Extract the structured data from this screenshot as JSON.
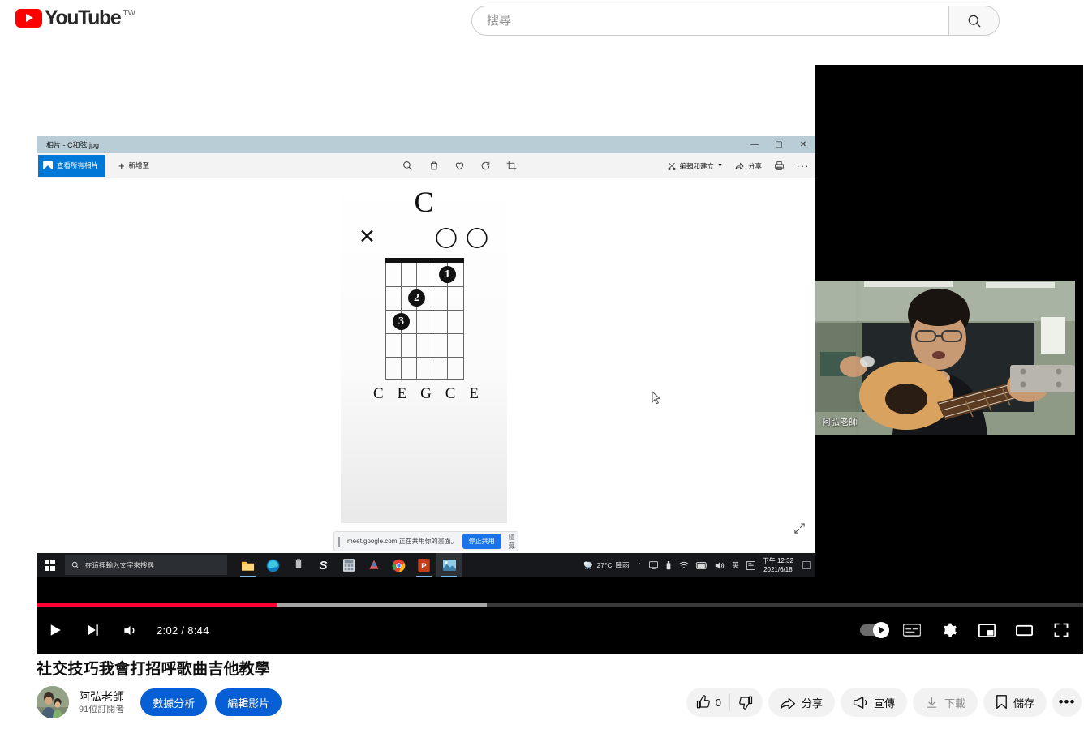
{
  "masthead": {
    "logo_text": "YouTube",
    "country_code": "TW",
    "logo_icon": "youtube-play-icon",
    "search": {
      "placeholder": "搜尋",
      "value": "",
      "button_icon": "search-icon"
    }
  },
  "player": {
    "time_display": "2:02 / 8:44",
    "current_time": "2:02",
    "duration": "8:44",
    "progress_played_pct": 23,
    "progress_buffer_pct": 43,
    "accent_color": "#ff0033",
    "controls": {
      "play_icon": "play-icon",
      "next_icon": "next-video-icon",
      "volume_icon": "volume-icon",
      "autoplay_icon": "autoplay-toggle",
      "subtitles_icon": "subtitles-icon",
      "settings_icon": "gear-icon",
      "miniplayer_icon": "miniplayer-icon",
      "theater_icon": "theater-mode-icon",
      "fullscreen_icon": "fullscreen-icon"
    },
    "webcam_overlay": {
      "name_label": "阿弘老師"
    }
  },
  "photos_app": {
    "window_title": "相片 - C和弦.jpg",
    "minimize_glyph": "—",
    "maximize_glyph": "▢",
    "close_glyph": "✕",
    "view_all_label": "查看所有相片",
    "add_to_label": "新增至",
    "add_to_glyph": "+",
    "center_icons": [
      "zoom-icon",
      "delete-icon",
      "favorite-heart-icon",
      "rotate-icon",
      "crop-icon"
    ],
    "edit_create_label": "編輯和建立",
    "share_label": "分享",
    "print_icon": "print-icon",
    "more_icon": "more-horizontal-icon",
    "expand_icon": "expand-image-icon"
  },
  "chord_image": {
    "chord_name": "C",
    "string_markers": [
      "X",
      "",
      "",
      "O",
      "",
      "O"
    ],
    "fingers": [
      {
        "label": "1",
        "string": 5,
        "fret": 1
      },
      {
        "label": "2",
        "string": 3,
        "fret": 2
      },
      {
        "label": "3",
        "string": 2,
        "fret": 3
      }
    ],
    "note_names": [
      "C",
      "E",
      "G",
      "C",
      "E"
    ],
    "fret_count": 5,
    "string_count": 6
  },
  "meet_bar": {
    "message": "meet.google.com 正在共用你的畫面。",
    "stop_label": "停止共用",
    "hide_label": "隱藏",
    "grip_icon": "drag-grip-icon"
  },
  "taskbar": {
    "start_icon": "windows-start-icon",
    "search_icon": "search-icon",
    "search_placeholder": "在這裡輸入文字來搜尋",
    "apps": [
      {
        "name": "file-explorer",
        "glyph": "📁"
      },
      {
        "name": "microsoft-edge",
        "glyph": "e"
      },
      {
        "name": "usb-device",
        "glyph": "▮"
      },
      {
        "name": "snip-tool",
        "glyph": "S"
      },
      {
        "name": "calculator",
        "glyph": "▤"
      },
      {
        "name": "team-app",
        "glyph": "▲"
      },
      {
        "name": "google-chrome",
        "glyph": "◉"
      },
      {
        "name": "powerpoint",
        "glyph": "P"
      },
      {
        "name": "photos-app",
        "glyph": "🖼"
      }
    ],
    "weather_temp": "27°C",
    "weather_desc": "陣雨",
    "tray_icons": [
      "chevron-up-icon",
      "display-icon",
      "usb-icon",
      "wifi-icon",
      "battery-icon",
      "volume-icon",
      "ime-icon",
      "action-center-icon"
    ],
    "ime_label": "英",
    "clock_time": "下午 12:32",
    "clock_date": "2021/6/18"
  },
  "video_info": {
    "title": "社交技巧我會打招呼歌曲吉他教學",
    "channel_name": "阿弘老師",
    "subscriber_count": "91位訂閱者",
    "analytics_label": "數據分析",
    "edit_video_label": "編輯影片"
  },
  "actions": {
    "like_count": "0",
    "like_icon": "thumbs-up-icon",
    "dislike_icon": "thumbs-down-icon",
    "share_label": "分享",
    "share_icon": "share-arrow-icon",
    "promote_label": "宣傳",
    "promote_icon": "megaphone-icon",
    "download_label": "下載",
    "download_icon": "download-icon",
    "save_label": "儲存",
    "save_icon": "bookmark-icon",
    "more_glyph": "•••"
  }
}
